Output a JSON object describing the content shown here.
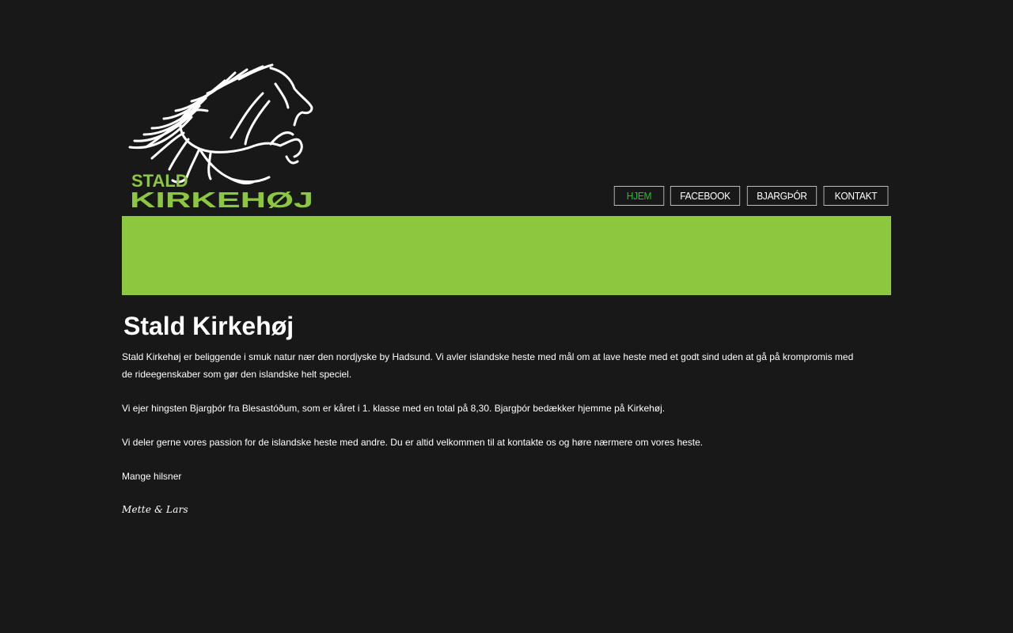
{
  "logo": {
    "line1": "STALD",
    "line2": "KIRKEHØJ",
    "icon": "horse-icon",
    "accent_color": "#8dc63f"
  },
  "nav": {
    "items": [
      {
        "label": "HJEM",
        "active": true
      },
      {
        "label": "FACEBOOK",
        "active": false
      },
      {
        "label": "BJARGÞÓR",
        "active": false
      },
      {
        "label": "KONTAKT",
        "active": false
      }
    ],
    "active_color": "#22c22a"
  },
  "banner": {
    "color": "#8dc63f"
  },
  "main": {
    "title": "Stald Kirkehøj",
    "paragraphs": [
      "Stald Kirkehøj er beliggende i smuk natur nær den nordjyske by Hadsund. Vi avler islandske heste med mål om at lave  heste med et godt sind uden at gå på krompromis med de rideegenskaber som gør den islandske helt speciel.",
      "Vi ejer hingsten Bjargþór fra Blesastóðum, som er kåret i 1. klasse med en total på 8,30. Bjargþór bedækker hjemme på Kirkehøj.",
      "Vi deler gerne vores passion for de islandske heste med andre. Du er altid velkommen til at kontakte os og høre nærmere om vores heste.",
      "Mange hilsner"
    ],
    "signature": "Mette &  Lars"
  },
  "colors": {
    "background": "#181818",
    "text": "#ffffff"
  }
}
